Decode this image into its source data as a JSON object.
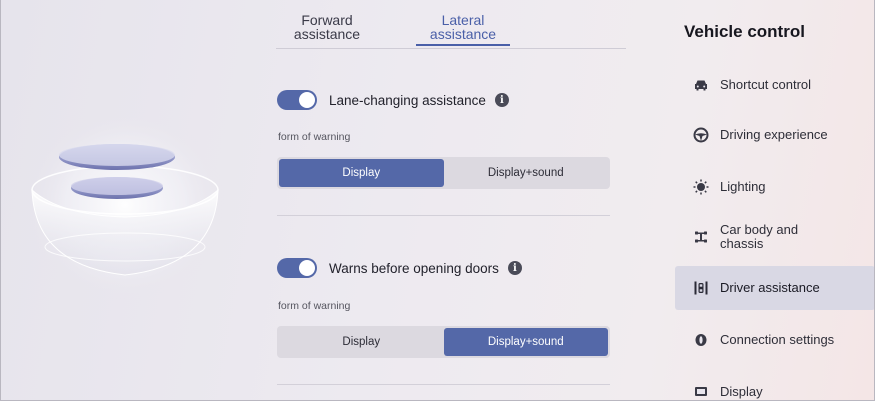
{
  "tabs": [
    {
      "label": "Forward assistance",
      "active": false
    },
    {
      "label": "Lateral assistance",
      "active": true
    }
  ],
  "settings": [
    {
      "label": "Lane-changing assistance",
      "enabled": true,
      "form_label": "form of warning",
      "options": [
        "Display",
        "Display+sound"
      ],
      "selected": "Display"
    },
    {
      "label": "Warns before opening doors",
      "enabled": true,
      "form_label": "form of warning",
      "options": [
        "Display",
        "Display+sound"
      ],
      "selected": "Display+sound"
    }
  ],
  "panel": {
    "title": "Vehicle control",
    "items": [
      {
        "label": "Shortcut control",
        "icon": "car-icon",
        "active": false
      },
      {
        "label": "Driving experience",
        "icon": "steering-wheel-icon",
        "active": false
      },
      {
        "label": "Lighting",
        "icon": "light-bulb-icon",
        "active": false
      },
      {
        "label": "Car body and chassis",
        "icon": "chassis-icon",
        "active": false
      },
      {
        "label": "Driver assistance",
        "icon": "lane-assist-icon",
        "active": true
      },
      {
        "label": "Connection settings",
        "icon": "connection-icon",
        "active": false
      },
      {
        "label": "Display",
        "icon": "display-icon",
        "active": false
      }
    ]
  },
  "colors": {
    "accent": "#5468a8",
    "background": "#ebe8ee",
    "active_item": "#d9d8e4"
  }
}
